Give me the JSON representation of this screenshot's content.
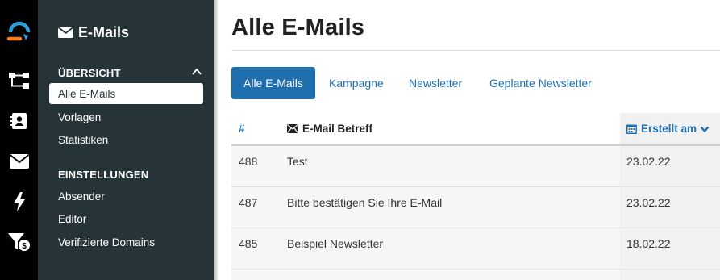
{
  "rail": {
    "items": [
      {
        "icon": "logo-icon"
      },
      {
        "icon": "flow-icon"
      },
      {
        "icon": "contacts-icon"
      },
      {
        "icon": "email-icon"
      },
      {
        "icon": "lightning-icon"
      },
      {
        "icon": "funnel-icon"
      }
    ]
  },
  "sidebar": {
    "title": "E-Mails",
    "section_overview": "ÜBERSICHT",
    "overview_items": [
      "Alle E-Mails",
      "Vorlagen",
      "Statistiken"
    ],
    "section_settings": "EINSTELLUNGEN",
    "settings_items": [
      "Absender",
      "Editor",
      "Verifizierte Domains"
    ]
  },
  "main": {
    "title": "Alle E-Mails",
    "tabs": [
      "Alle E-Mails",
      "Kampagne",
      "Newsletter",
      "Geplante Newsletter"
    ],
    "columns": {
      "id": "#",
      "subject": "E-Mail Betreff",
      "created": "Erstellt am"
    },
    "rows": [
      {
        "id": "488",
        "subject": "Test",
        "date": "23.02.22"
      },
      {
        "id": "487",
        "subject": "Bitte bestätigen Sie Ihre E-Mail",
        "date": "23.02.22"
      },
      {
        "id": "485",
        "subject": "Beispiel Newsletter",
        "date": "18.02.22"
      }
    ]
  },
  "colors": {
    "sidebar_bg": "#263438",
    "accent": "#1f6fae",
    "rail_logo": "#2a9fd8",
    "rail_logo_accent": "#f47a20"
  }
}
